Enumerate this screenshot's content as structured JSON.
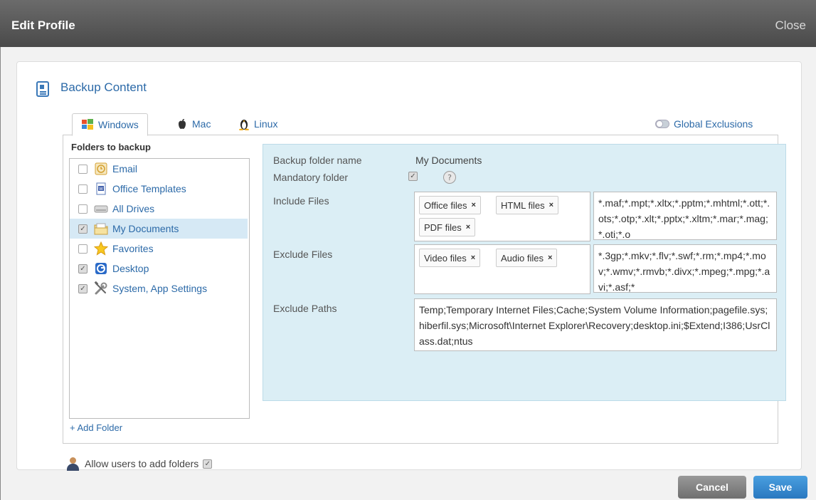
{
  "window": {
    "title": "Edit Profile",
    "close_label": "Close"
  },
  "section": {
    "title": "Backup Content"
  },
  "tabs": [
    {
      "label": "Windows",
      "icon": "windows-icon",
      "active": true
    },
    {
      "label": "Mac",
      "icon": "apple-icon",
      "active": false
    },
    {
      "label": "Linux",
      "icon": "linux-icon",
      "active": false
    }
  ],
  "global_exclusions_label": "Global Exclusions",
  "folders": {
    "heading": "Folders to backup",
    "items": [
      {
        "label": "Email",
        "checked": false,
        "icon": "email-icon"
      },
      {
        "label": "Office Templates",
        "checked": false,
        "icon": "document-icon"
      },
      {
        "label": "All Drives",
        "checked": false,
        "icon": "drive-icon"
      },
      {
        "label": "My Documents",
        "checked": true,
        "selected": true,
        "icon": "folder-icon"
      },
      {
        "label": "Favorites",
        "checked": false,
        "icon": "star-icon"
      },
      {
        "label": "Desktop",
        "checked": true,
        "icon": "desktop-icon"
      },
      {
        "label": "System, App Settings",
        "checked": true,
        "icon": "settings-icon"
      }
    ],
    "add_label": "+ Add Folder"
  },
  "detail": {
    "folder_name_label": "Backup folder name",
    "folder_name_value": "My Documents",
    "mandatory_label": "Mandatory folder",
    "mandatory_checked": true,
    "include_label": "Include Files",
    "include_tags": [
      "Office files",
      "HTML files",
      "PDF files"
    ],
    "include_ext": "*.maf;*.mpt;*.xltx;*.pptm;*.mhtml;*.ott;*.ots;*.otp;*.xlt;*.pptx;*.xltm;*.mar;*.mag;*.oti;*.o",
    "exclude_label": "Exclude Files",
    "exclude_tags": [
      "Video files",
      "Audio files"
    ],
    "exclude_ext": "*.3gp;*.mkv;*.flv;*.swf;*.rm;*.mp4;*.mov;*.wmv;*.rmvb;*.divx;*.mpeg;*.mpg;*.avi;*.asf;*",
    "paths_label": "Exclude Paths",
    "paths_value": "Temp;Temporary Internet Files;Cache;System Volume Information;pagefile.sys;hiberfil.sys;Microsoft\\Internet Explorer\\Recovery;desktop.ini;$Extend;I386;UsrClass.dat;ntus"
  },
  "allow_users_label": "Allow users to add folders",
  "allow_users_checked": true,
  "buttons": {
    "cancel": "Cancel",
    "save": "Save"
  }
}
